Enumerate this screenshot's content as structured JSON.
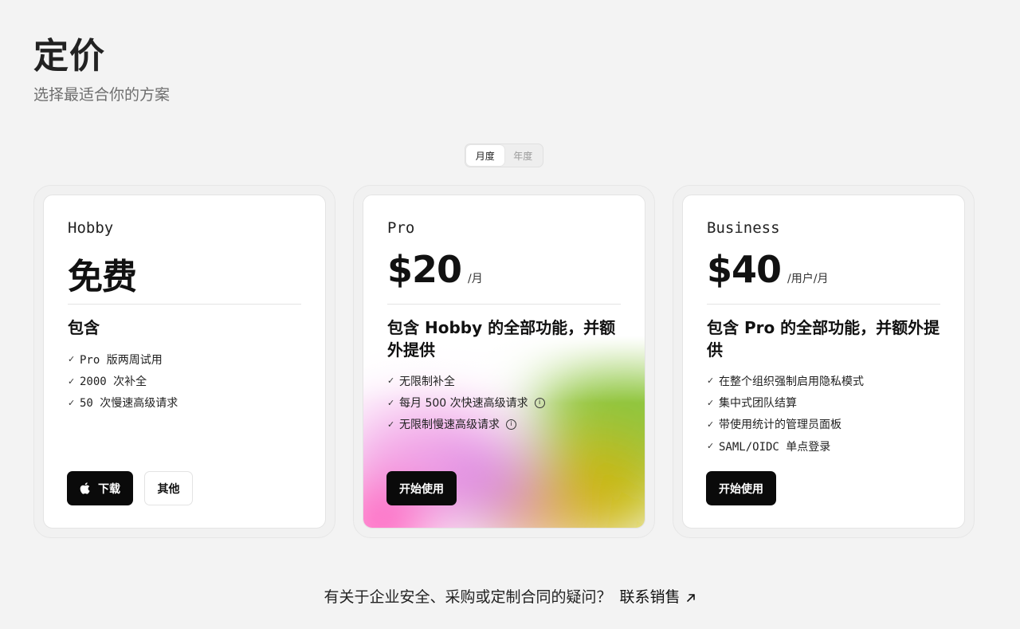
{
  "header": {
    "title": "定价",
    "subtitle": "选择最适合你的方案"
  },
  "billing_toggle": {
    "options": [
      "月度",
      "年度"
    ],
    "selected": "月度"
  },
  "plans": [
    {
      "name": "Hobby",
      "price": "免费",
      "unit": "",
      "includes_heading": "包含",
      "features": [
        {
          "text": "Pro 版两周试用",
          "info": false
        },
        {
          "text": "2000 次补全",
          "info": false
        },
        {
          "text": "50 次慢速高级请求",
          "info": false
        }
      ],
      "buttons": [
        {
          "label": "下载",
          "icon": "apple-icon",
          "style": "dark"
        },
        {
          "label": "其他",
          "style": "light"
        }
      ]
    },
    {
      "name": "Pro",
      "price": "$20",
      "unit": "/月",
      "includes_heading": "包含 Hobby 的全部功能，并额外提供",
      "features": [
        {
          "text": "无限制补全",
          "info": false
        },
        {
          "text": "每月 500 次快速高级请求",
          "info": true
        },
        {
          "text": "无限制慢速高级请求",
          "info": true
        }
      ],
      "buttons": [
        {
          "label": "开始使用",
          "style": "dark"
        }
      ]
    },
    {
      "name": "Business",
      "price": "$40",
      "unit": "/用户/月",
      "includes_heading": "包含 Pro 的全部功能，并额外提供",
      "features": [
        {
          "text": "在整个组织强制启用隐私模式",
          "info": false
        },
        {
          "text": "集中式团队结算",
          "info": false
        },
        {
          "text": "带使用统计的管理员面板",
          "info": false
        },
        {
          "text": "SAML/OIDC 单点登录",
          "info": false
        }
      ],
      "buttons": [
        {
          "label": "开始使用",
          "style": "dark"
        }
      ]
    }
  ],
  "icons": {
    "check": "✓",
    "info": "i"
  },
  "footer": {
    "question": "有关于企业安全、采购或定制合同的疑问？",
    "link_label": "联系销售"
  }
}
